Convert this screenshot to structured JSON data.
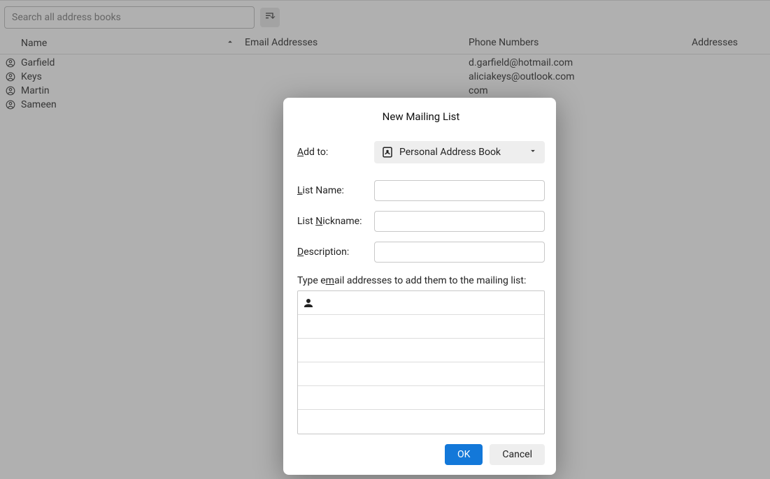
{
  "toolbar": {
    "search_placeholder": "Search all address books"
  },
  "columns": {
    "name": "Name",
    "email": "Email Addresses",
    "phone": "Phone Numbers",
    "addresses": "Addresses"
  },
  "contacts": [
    {
      "name": "Garfield",
      "phone": "d.garfield@hotmail.com"
    },
    {
      "name": "Keys",
      "phone": "aliciakeys@outlook.com"
    },
    {
      "name": "Martin",
      "phone": "com"
    },
    {
      "name": "Sameen",
      "phone": ""
    }
  ],
  "dialog": {
    "title": "New Mailing List",
    "add_to_label": "Add to:",
    "add_to_value": "Personal Address Book",
    "list_name_label": "List Name:",
    "list_nickname_label": "List Nickname:",
    "description_label": "Description:",
    "hint": "Type email addresses to add them to the mailing list:",
    "ok": "OK",
    "cancel": "Cancel",
    "list_name_value": "",
    "list_nickname_value": "",
    "description_value": ""
  }
}
